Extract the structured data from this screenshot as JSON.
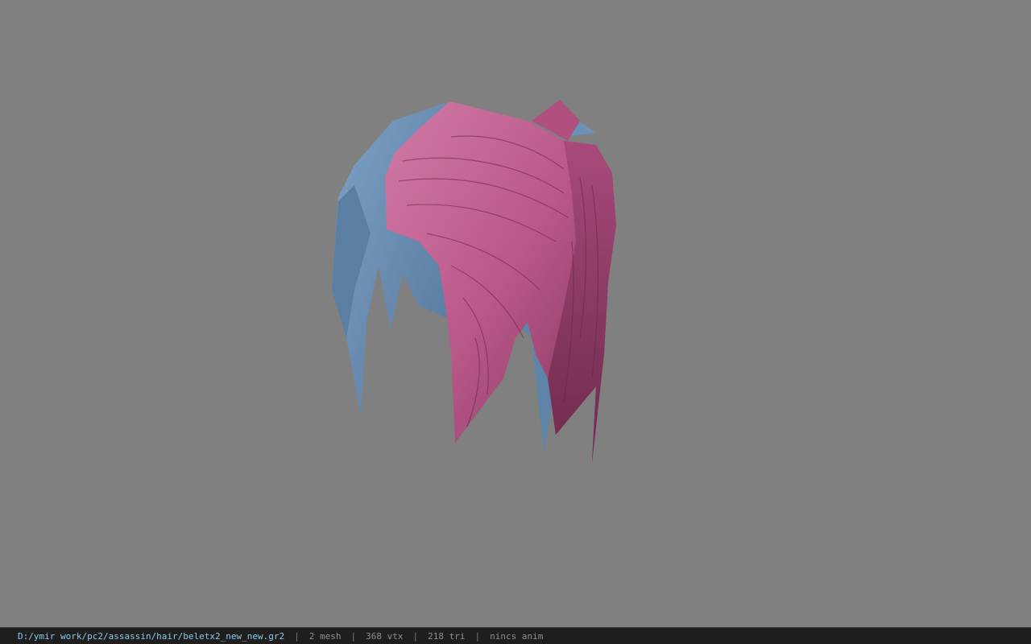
{
  "viewport": {
    "background_color": "#808080",
    "model": {
      "name": "hair-mesh",
      "colors": {
        "pink": "#c0608f",
        "pink_dark": "#7a2f52",
        "blue": "#6a8fb5",
        "blue_dark": "#50708f"
      }
    }
  },
  "status_bar": {
    "file_path": "D:/ymir work/pc2/assassin/hair/beletx2_new_new.gr2",
    "separator": "|",
    "mesh_count": "2 mesh",
    "vertex_count": "368 vtx",
    "triangle_count": "218 tri",
    "anim_status": "nincs anim"
  }
}
